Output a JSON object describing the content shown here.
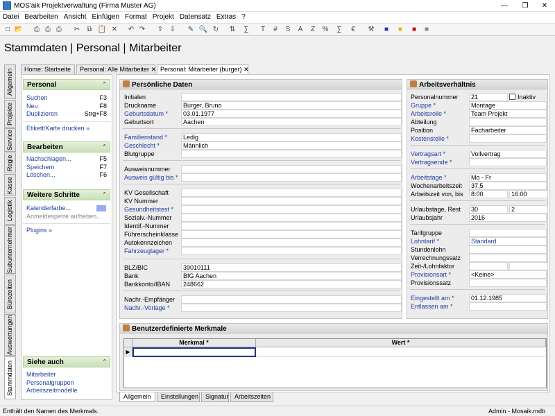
{
  "window": {
    "title": "MOS'aik Projektverwaltung (Firma Muster AG)"
  },
  "menu": [
    "Datei",
    "Bearbeiten",
    "Ansicht",
    "Einfügen",
    "Format",
    "Projekt",
    "Datensatz",
    "Extras",
    "?"
  ],
  "toolbar_icons": [
    "new-icon",
    "open-icon",
    "print-icon",
    "print-preview-icon",
    "cut-icon",
    "copy-icon",
    "paste-icon",
    "delete-icon",
    "undo-icon",
    "redo-icon",
    "arrow-up-icon",
    "arrow-down-icon",
    "edit-icon",
    "find-icon",
    "refresh-icon",
    "sort-icon",
    "sum-icon",
    "text-format-icon",
    "number-format-icon",
    "text-format2-icon",
    "currency-format-icon",
    "percent-format-icon",
    "decimal-format-icon",
    "euro-format-icon",
    "tools-icon",
    "user-blue-icon",
    "user-yellow-icon",
    "user-red-icon",
    "user-gray-icon"
  ],
  "page_title": "Stammdaten | Personal | Mitarbeiter",
  "doc_tabs": [
    "Home: Startseite",
    "Personal: Alle Mitarbeiter",
    "Personal: Mitarbeiter (burger)"
  ],
  "vtabs": [
    "Allgemein",
    "Projekte",
    "Service",
    "Regie",
    "Kasse",
    "Logistik",
    "Subunternehmer",
    "Bürozeiten",
    "Auswertungen",
    "Stammdaten"
  ],
  "left": {
    "personal": {
      "title": "Personal",
      "items": [
        {
          "label": "Suchen",
          "shortcut": "F3"
        },
        {
          "label": "Neu",
          "shortcut": "F8"
        },
        {
          "label": "Duplizieren",
          "shortcut": "Strg+F8"
        }
      ],
      "extra": "Etikett/Karte drucken »"
    },
    "bearbeiten": {
      "title": "Bearbeiten",
      "items": [
        {
          "label": "Nachschlagen...",
          "shortcut": "F5"
        },
        {
          "label": "Speichern",
          "shortcut": "F7"
        },
        {
          "label": "Löschen...",
          "shortcut": "F6"
        }
      ]
    },
    "weitere": {
      "title": "Weitere Schritte",
      "items": [
        {
          "label": "Kalenderfarbe..."
        },
        {
          "label": "Anmeldesperre aufheben..."
        }
      ],
      "extra": "Plugins »"
    },
    "siehe": {
      "title": "Siehe auch",
      "items": [
        "Mitarbeiter",
        "Personalgruppen",
        "Arbeitszeitmodelle"
      ]
    }
  },
  "personal": {
    "title": "Persönliche Daten",
    "fields": [
      {
        "label": "Initialen",
        "value": ""
      },
      {
        "label": "Druckname",
        "value": "Burger, Bruno"
      },
      {
        "label": "Geburtsdatum *",
        "value": "03.01.1977"
      },
      {
        "label": "Geburtsort",
        "value": "Aachen"
      },
      {
        "label": "Familienstand *",
        "value": "Ledig"
      },
      {
        "label": "Geschlecht *",
        "value": "Männlich"
      },
      {
        "label": "Blutgruppe",
        "value": ""
      },
      {
        "label": "Ausweisnummer",
        "value": ""
      },
      {
        "label": "Ausweis gültig bis *",
        "value": ""
      },
      {
        "label": "KV Gesellschaft",
        "value": ""
      },
      {
        "label": "KV Nummer",
        "value": ""
      },
      {
        "label": "Gesundheitstest *",
        "value": ""
      },
      {
        "label": "Sozialv.-Nummer",
        "value": ""
      },
      {
        "label": "Identif.-Nummer",
        "value": ""
      },
      {
        "label": "Führerscheinklasse",
        "value": ""
      },
      {
        "label": "Autokennzeichen",
        "value": ""
      },
      {
        "label": "Fahrzeuglager *",
        "value": ""
      },
      {
        "label": "BLZ/BIC",
        "value": "39010111"
      },
      {
        "label": "Bank",
        "value": "BfG Aachen"
      },
      {
        "label": "Bankkonto/IBAN",
        "value": "248662"
      },
      {
        "label": "Nachr.-Empfänger",
        "value": ""
      },
      {
        "label": "Nachr.-Vorlage *",
        "value": ""
      }
    ]
  },
  "arbeit": {
    "title": "Arbeitsverhältnis",
    "inaktiv_label": "Inaktiv",
    "fields": [
      {
        "label": "Personalnummer",
        "value": "21"
      },
      {
        "label": "Gruppe *",
        "value": "Montage"
      },
      {
        "label": "Arbeitsrolle *",
        "value": "Team Projekt"
      },
      {
        "label": "Abteilung",
        "value": ""
      },
      {
        "label": "Position",
        "value": "Facharbeiter"
      },
      {
        "label": "Kostenstelle *",
        "value": ""
      },
      {
        "label": "Vertragsart *",
        "value": "Vollvertrag"
      },
      {
        "label": "Vertragsende *",
        "value": ""
      },
      {
        "label": "Arbeitstage *",
        "value": "Mo - Fr"
      },
      {
        "label": "Wochenarbeitszeit",
        "value": "37,5"
      },
      {
        "label": "Arbeitszeit von, bis",
        "value": "8:00",
        "value2": "16:00"
      },
      {
        "label": "Urlaubstage, Rest",
        "value": "30",
        "value2": "2"
      },
      {
        "label": "Urlaubsjahr",
        "value": "2016"
      },
      {
        "label": "Tarifgruppe",
        "value": ""
      },
      {
        "label": "Lohntarif *",
        "value": "Standard"
      },
      {
        "label": "Stundenlohn",
        "value": ""
      },
      {
        "label": "Verrechnungssatz",
        "value": ""
      },
      {
        "label": "Zeit-/Lohnfaktor",
        "value": "",
        "value2": ""
      },
      {
        "label": "Provisionsart *",
        "value": "<Keine>"
      },
      {
        "label": "Provisionssatz",
        "value": ""
      },
      {
        "label": "Eingestellt am *",
        "value": "01.12.1985"
      },
      {
        "label": "Entlassen am *",
        "value": ""
      }
    ]
  },
  "merkmale": {
    "title": "Benutzerdefinierte Merkmale",
    "col1": "Merkmal *",
    "col2": "Wert *"
  },
  "bottom_tabs": [
    "Allgemein",
    "Einstellungen",
    "Signatur",
    "Arbeitszeiten"
  ],
  "status": {
    "message": "Enthält den Namen des Merkmals.",
    "db": "Admin - Mosaik.mdb"
  },
  "colors": {
    "link": "#1f3fa0",
    "panel_head": "#c8e0b8",
    "calendar": "#9aaaf0"
  }
}
